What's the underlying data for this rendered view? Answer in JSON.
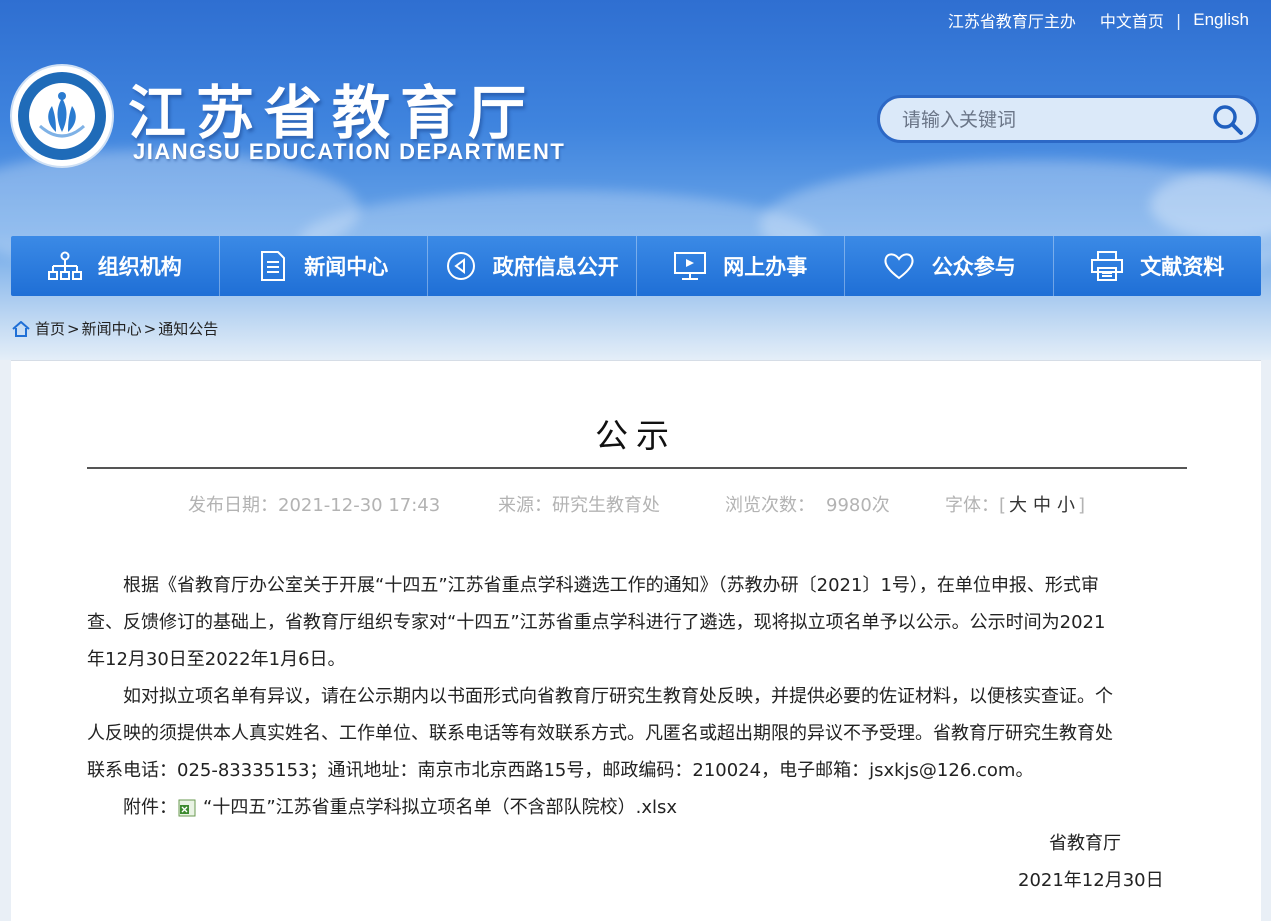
{
  "header": {
    "host_text": "江苏省教育厅主办",
    "home_link": "中文首页",
    "separator": "|",
    "english_link": "English",
    "site_title": "江苏省教育厅",
    "site_subtitle": "JIANGSU EDUCATION DEPARTMENT",
    "search_placeholder": "请输入关键词"
  },
  "nav": [
    {
      "label": "组织机构",
      "icon": "org-chart-icon"
    },
    {
      "label": "新闻中心",
      "icon": "document-icon"
    },
    {
      "label": "政府信息公开",
      "icon": "megaphone-icon"
    },
    {
      "label": "网上办事",
      "icon": "monitor-icon"
    },
    {
      "label": "公众参与",
      "icon": "heart-icon"
    },
    {
      "label": "文献资料",
      "icon": "printer-icon"
    }
  ],
  "breadcrumb": {
    "home": "首页",
    "sep": ">",
    "level1": "新闻中心",
    "level2": "通知公告"
  },
  "article": {
    "title": "公示",
    "publish_label": "发布日期：2021-12-30 17:43",
    "source_label": "来源：研究生教育处",
    "views_label": "浏览次数：",
    "views_value": "9980次",
    "font_label": "字体：[",
    "font_large": "大",
    "font_medium": "中",
    "font_small": "小",
    "font_close": "]",
    "para1_l1": "根据《省教育厅办公室关于开展“十四五”江苏省重点学科遴选工作的通知》（苏教办研〔2021〕1号），在单位申报、形式审",
    "para1_l2": "查、反馈修订的基础上，省教育厅组织专家对“十四五”江苏省重点学科进行了遴选，现将拟立项名单予以公示。公示时间为2021",
    "para1_l3": "年12月30日至2022年1月6日。",
    "para2_l1": "如对拟立项名单有异议，请在公示期内以书面形式向省教育厅研究生教育处反映，并提供必要的佐证材料，以便核实查证。个",
    "para2_l2": "人反映的须提供本人真实姓名、工作单位、联系电话等有效联系方式。凡匿名或超出期限的异议不予受理。省教育厅研究生教育处",
    "para2_l3": "联系电话：025-83335153；通讯地址：南京市北京西路15号，邮政编码：210024，电子邮箱：jsxkjs@126.com。",
    "attachment_label": "附件：",
    "attachment_name": "“十四五”江苏省重点学科拟立项名单（不含部队院校）.xlsx",
    "signature": "省教育厅",
    "date": "2021年12月30日"
  },
  "colors": {
    "nav_blue": "#1f6fd6",
    "banner_top": "#2f6fd1",
    "meta_gray": "#b3b3b3"
  }
}
